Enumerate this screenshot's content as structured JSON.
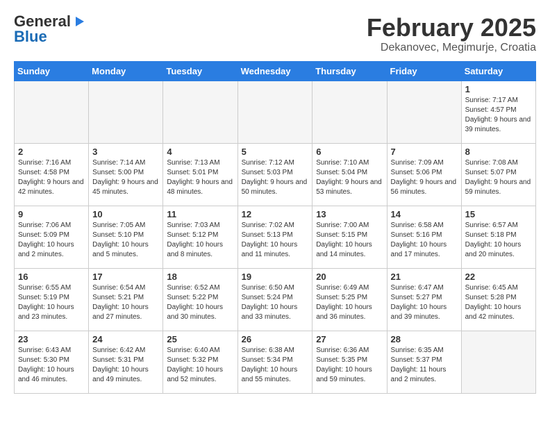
{
  "header": {
    "logo_general": "General",
    "logo_blue": "Blue",
    "title": "February 2025",
    "subtitle": "Dekanovec, Megimurje, Croatia"
  },
  "days_of_week": [
    "Sunday",
    "Monday",
    "Tuesday",
    "Wednesday",
    "Thursday",
    "Friday",
    "Saturday"
  ],
  "weeks": [
    [
      {
        "day": "",
        "info": ""
      },
      {
        "day": "",
        "info": ""
      },
      {
        "day": "",
        "info": ""
      },
      {
        "day": "",
        "info": ""
      },
      {
        "day": "",
        "info": ""
      },
      {
        "day": "",
        "info": ""
      },
      {
        "day": "1",
        "info": "Sunrise: 7:17 AM\nSunset: 4:57 PM\nDaylight: 9 hours and 39 minutes."
      }
    ],
    [
      {
        "day": "2",
        "info": "Sunrise: 7:16 AM\nSunset: 4:58 PM\nDaylight: 9 hours and 42 minutes."
      },
      {
        "day": "3",
        "info": "Sunrise: 7:14 AM\nSunset: 5:00 PM\nDaylight: 9 hours and 45 minutes."
      },
      {
        "day": "4",
        "info": "Sunrise: 7:13 AM\nSunset: 5:01 PM\nDaylight: 9 hours and 48 minutes."
      },
      {
        "day": "5",
        "info": "Sunrise: 7:12 AM\nSunset: 5:03 PM\nDaylight: 9 hours and 50 minutes."
      },
      {
        "day": "6",
        "info": "Sunrise: 7:10 AM\nSunset: 5:04 PM\nDaylight: 9 hours and 53 minutes."
      },
      {
        "day": "7",
        "info": "Sunrise: 7:09 AM\nSunset: 5:06 PM\nDaylight: 9 hours and 56 minutes."
      },
      {
        "day": "8",
        "info": "Sunrise: 7:08 AM\nSunset: 5:07 PM\nDaylight: 9 hours and 59 minutes."
      }
    ],
    [
      {
        "day": "9",
        "info": "Sunrise: 7:06 AM\nSunset: 5:09 PM\nDaylight: 10 hours and 2 minutes."
      },
      {
        "day": "10",
        "info": "Sunrise: 7:05 AM\nSunset: 5:10 PM\nDaylight: 10 hours and 5 minutes."
      },
      {
        "day": "11",
        "info": "Sunrise: 7:03 AM\nSunset: 5:12 PM\nDaylight: 10 hours and 8 minutes."
      },
      {
        "day": "12",
        "info": "Sunrise: 7:02 AM\nSunset: 5:13 PM\nDaylight: 10 hours and 11 minutes."
      },
      {
        "day": "13",
        "info": "Sunrise: 7:00 AM\nSunset: 5:15 PM\nDaylight: 10 hours and 14 minutes."
      },
      {
        "day": "14",
        "info": "Sunrise: 6:58 AM\nSunset: 5:16 PM\nDaylight: 10 hours and 17 minutes."
      },
      {
        "day": "15",
        "info": "Sunrise: 6:57 AM\nSunset: 5:18 PM\nDaylight: 10 hours and 20 minutes."
      }
    ],
    [
      {
        "day": "16",
        "info": "Sunrise: 6:55 AM\nSunset: 5:19 PM\nDaylight: 10 hours and 23 minutes."
      },
      {
        "day": "17",
        "info": "Sunrise: 6:54 AM\nSunset: 5:21 PM\nDaylight: 10 hours and 27 minutes."
      },
      {
        "day": "18",
        "info": "Sunrise: 6:52 AM\nSunset: 5:22 PM\nDaylight: 10 hours and 30 minutes."
      },
      {
        "day": "19",
        "info": "Sunrise: 6:50 AM\nSunset: 5:24 PM\nDaylight: 10 hours and 33 minutes."
      },
      {
        "day": "20",
        "info": "Sunrise: 6:49 AM\nSunset: 5:25 PM\nDaylight: 10 hours and 36 minutes."
      },
      {
        "day": "21",
        "info": "Sunrise: 6:47 AM\nSunset: 5:27 PM\nDaylight: 10 hours and 39 minutes."
      },
      {
        "day": "22",
        "info": "Sunrise: 6:45 AM\nSunset: 5:28 PM\nDaylight: 10 hours and 42 minutes."
      }
    ],
    [
      {
        "day": "23",
        "info": "Sunrise: 6:43 AM\nSunset: 5:30 PM\nDaylight: 10 hours and 46 minutes."
      },
      {
        "day": "24",
        "info": "Sunrise: 6:42 AM\nSunset: 5:31 PM\nDaylight: 10 hours and 49 minutes."
      },
      {
        "day": "25",
        "info": "Sunrise: 6:40 AM\nSunset: 5:32 PM\nDaylight: 10 hours and 52 minutes."
      },
      {
        "day": "26",
        "info": "Sunrise: 6:38 AM\nSunset: 5:34 PM\nDaylight: 10 hours and 55 minutes."
      },
      {
        "day": "27",
        "info": "Sunrise: 6:36 AM\nSunset: 5:35 PM\nDaylight: 10 hours and 59 minutes."
      },
      {
        "day": "28",
        "info": "Sunrise: 6:35 AM\nSunset: 5:37 PM\nDaylight: 11 hours and 2 minutes."
      },
      {
        "day": "",
        "info": ""
      }
    ]
  ]
}
